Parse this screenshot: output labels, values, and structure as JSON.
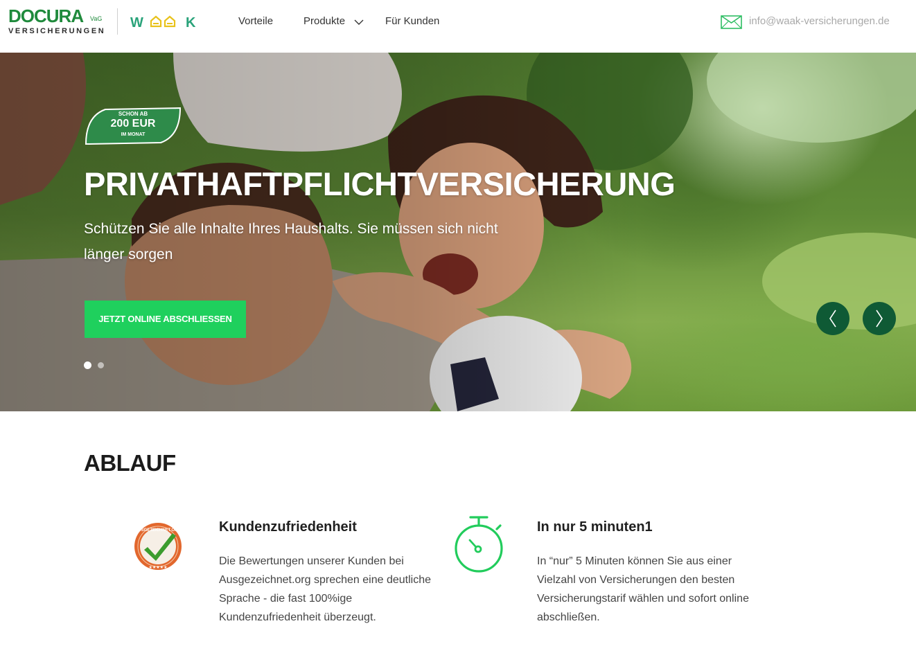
{
  "brand": {
    "docura_main": "DOCURA",
    "docura_suffix": "VaG",
    "docura_sub": "VERSICHERUNGEN",
    "waak": "WAAK"
  },
  "nav": {
    "items": [
      {
        "label": "Vorteile"
      },
      {
        "label": "Produkte"
      },
      {
        "label": "Für Kunden"
      }
    ],
    "email": "info@waak-versicherungen.de"
  },
  "hero": {
    "badge": {
      "top": "SCHON AB",
      "price": "200 EUR",
      "bottom": "IM MONAT"
    },
    "title": "PRIVATHAFTPFLICHTVERSICHERUNG",
    "subtitle": "Schützen Sie alle Inhalte Ihres Haushalts. Sie müssen sich nicht länger sorgen",
    "cta": "JETZT ONLINE ABSCHLIESSEN",
    "slides_total": 2,
    "active_slide": 1
  },
  "ablauf": {
    "title": "ABLAUF",
    "features": [
      {
        "icon": "ausgezeichnet-seal-icon",
        "title": "Kundenzufriedenheit",
        "text": "Die Bewertungen unserer Kunden bei Ausgezeichnet.org sprechen eine deutliche Sprache - die fast 100%ige Kundenzufriedenheit überzeugt."
      },
      {
        "icon": "stopwatch-icon",
        "title": "In nur 5 minuten1",
        "text": "In “nur” 5 Minuten können Sie aus einer Vielzahl von Versicherungen den besten Versicherungstarif wählen und sofort online abschließen."
      }
    ],
    "seal_text": "AUSGEZEICHNET.ORG"
  },
  "colors": {
    "brand_green": "#1f8a3c",
    "cta_green": "#1fd05d",
    "arrow_green": "#0f5a35",
    "badge_green": "#2e8b4a"
  }
}
